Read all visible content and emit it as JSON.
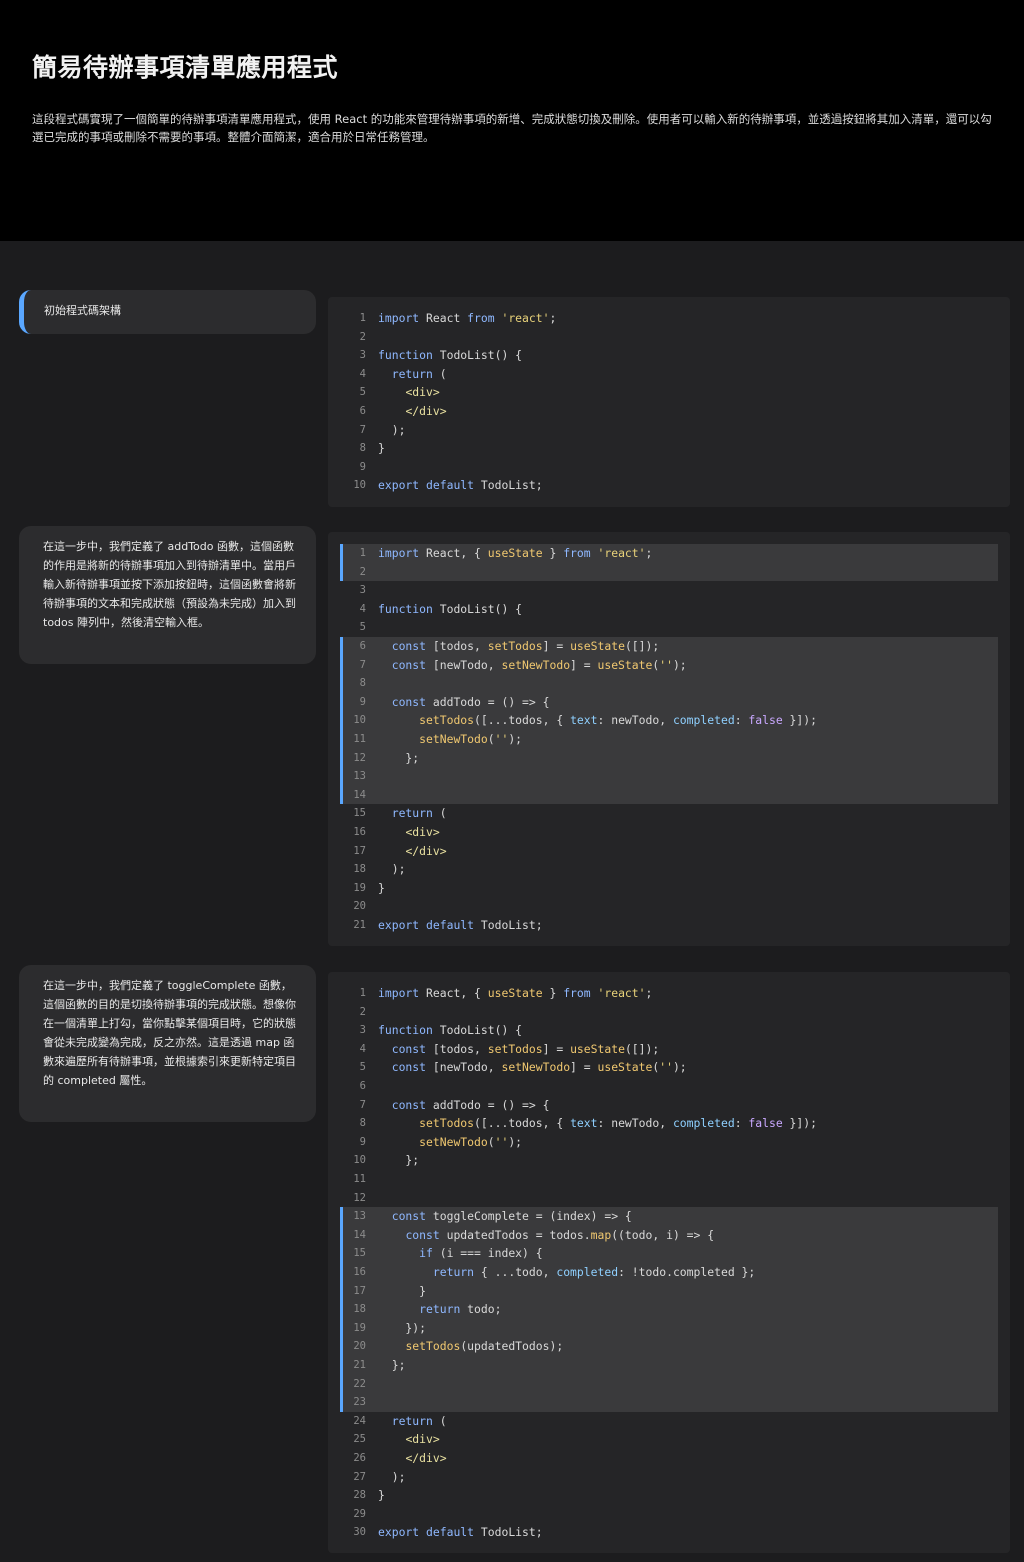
{
  "header": {
    "title": "簡易待辦事項清單應用程式",
    "description": "這段程式碼實現了一個簡單的待辦事項清單應用程式，使用 React 的功能來管理待辦事項的新增、完成狀態切換及刪除。使用者可以輸入新的待辦事項，並透過按鈕將其加入清單，還可以勾選已完成的事項或刪除不需要的事項。整體介面簡潔，適合用於日常任務管理。"
  },
  "steps": [
    {
      "text": "初始程式碼架構",
      "code": [
        {
          "n": "1",
          "t": "import React from 'react';"
        },
        {
          "n": "2",
          "t": ""
        },
        {
          "n": "3",
          "t": "function TodoList() {"
        },
        {
          "n": "4",
          "t": "  return ("
        },
        {
          "n": "5",
          "t": "    <div>"
        },
        {
          "n": "6",
          "t": "    </div>"
        },
        {
          "n": "7",
          "t": "  );"
        },
        {
          "n": "8",
          "t": "}"
        },
        {
          "n": "9",
          "t": ""
        },
        {
          "n": "10",
          "t": "export default TodoList;"
        }
      ]
    },
    {
      "text": "在這一步中，我們定義了 addTodo 函數，這個函數的作用是將新的待辦事項加入到待辦清單中。當用戶輸入新待辦事項並按下添加按鈕時，這個函數會將新待辦事項的文本和完成狀態（預設為未完成）加入到 todos 陣列中，然後清空輸入框。",
      "code": [
        {
          "n": "1",
          "t": "import React, { useState } from 'react';"
        },
        {
          "n": "2",
          "t": ""
        },
        {
          "n": "3",
          "t": ""
        },
        {
          "n": "4",
          "t": "function TodoList() {"
        },
        {
          "n": "5",
          "t": ""
        },
        {
          "n": "6",
          "t": "  const [todos, setTodos] = useState([]);"
        },
        {
          "n": "7",
          "t": "  const [newTodo, setNewTodo] = useState('');"
        },
        {
          "n": "8",
          "t": ""
        },
        {
          "n": "9",
          "t": "  const addTodo = () => {"
        },
        {
          "n": "10",
          "t": "      setTodos([...todos, { text: newTodo, completed: false }]);"
        },
        {
          "n": "11",
          "t": "      setNewTodo('');"
        },
        {
          "n": "12",
          "t": "    };"
        },
        {
          "n": "13",
          "t": ""
        },
        {
          "n": "14",
          "t": ""
        },
        {
          "n": "15",
          "t": "  return ("
        },
        {
          "n": "16",
          "t": "    <div>"
        },
        {
          "n": "17",
          "t": "    </div>"
        },
        {
          "n": "18",
          "t": "  );"
        },
        {
          "n": "19",
          "t": "}"
        },
        {
          "n": "20",
          "t": ""
        },
        {
          "n": "21",
          "t": "export default TodoList;"
        }
      ]
    },
    {
      "text": "在這一步中，我們定義了 toggleComplete 函數，這個函數的目的是切換待辦事項的完成狀態。想像你在一個清單上打勾，當你點擊某個項目時，它的狀態會從未完成變為完成，反之亦然。這是透過 map 函數來遍歷所有待辦事項，並根據索引來更新特定項目的 completed 屬性。",
      "code": [
        {
          "n": "1",
          "t": "import React, { useState } from 'react';"
        },
        {
          "n": "2",
          "t": ""
        },
        {
          "n": "3",
          "t": "function TodoList() {"
        },
        {
          "n": "4",
          "t": "  const [todos, setTodos] = useState([]);"
        },
        {
          "n": "5",
          "t": "  const [newTodo, setNewTodo] = useState('');"
        },
        {
          "n": "6",
          "t": ""
        },
        {
          "n": "7",
          "t": "  const addTodo = () => {"
        },
        {
          "n": "8",
          "t": "      setTodos([...todos, { text: newTodo, completed: false }]);"
        },
        {
          "n": "9",
          "t": "      setNewTodo('');"
        },
        {
          "n": "10",
          "t": "    };"
        },
        {
          "n": "11",
          "t": ""
        },
        {
          "n": "12",
          "t": ""
        },
        {
          "n": "13",
          "t": "  const toggleComplete = (index) => {"
        },
        {
          "n": "14",
          "t": "    const updatedTodos = todos.map((todo, i) => {"
        },
        {
          "n": "15",
          "t": "      if (i === index) {"
        },
        {
          "n": "16",
          "t": "        return { ...todo, completed: !todo.completed };"
        },
        {
          "n": "17",
          "t": "      }"
        },
        {
          "n": "18",
          "t": "      return todo;"
        },
        {
          "n": "19",
          "t": "    });"
        },
        {
          "n": "20",
          "t": "    setTodos(updatedTodos);"
        },
        {
          "n": "21",
          "t": "  };"
        },
        {
          "n": "22",
          "t": ""
        },
        {
          "n": "23",
          "t": ""
        },
        {
          "n": "24",
          "t": "  return ("
        },
        {
          "n": "25",
          "t": "    <div>"
        },
        {
          "n": "26",
          "t": "    </div>"
        },
        {
          "n": "27",
          "t": "  );"
        },
        {
          "n": "28",
          "t": "}"
        },
        {
          "n": "29",
          "t": ""
        },
        {
          "n": "30",
          "t": "export default TodoList;"
        }
      ]
    }
  ]
}
